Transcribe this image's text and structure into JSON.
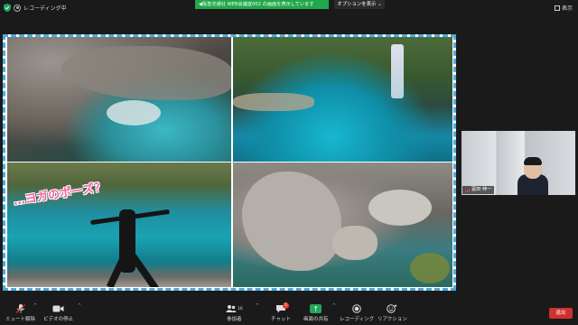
{
  "top_bar": {
    "recording_status": "レコーディング中",
    "share_banner": "◀︎阪急交通社 WEB会議室002 の画面を表示しています",
    "options_label": "オプションを表示 ⌄",
    "view_label": "表示"
  },
  "shared_screen": {
    "overlay_text": "…ヨガのポーズ？",
    "overlay_color": "#ff5ea0",
    "frame_color": "#4ea9dc"
  },
  "participant": {
    "name": "冨田 伸一"
  },
  "bottom_bar": {
    "mute_label": "ミュート解除",
    "video_label": "ビデオの停止",
    "participants_label": "参加者",
    "participants_count": "16",
    "chat_label": "チャット",
    "chat_badge": "5",
    "share_label": "画面の共有",
    "record_label": "レコーディング",
    "reaction_label": "リアクション",
    "leave_label": "退出",
    "accent_share": "#23a55a",
    "accent_leave": "#d0302f"
  }
}
